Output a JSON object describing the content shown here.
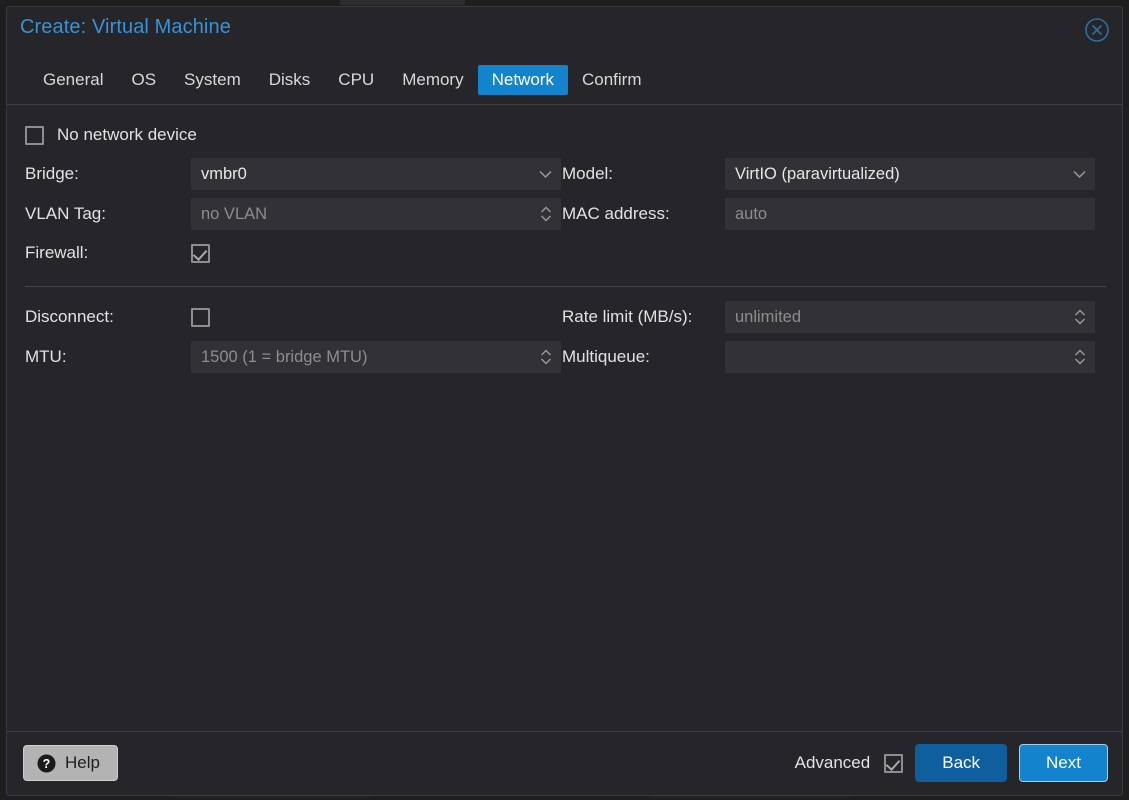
{
  "dialog": {
    "title": "Create: Virtual Machine",
    "close_icon": "close-circle-icon"
  },
  "tabs": [
    {
      "label": "General",
      "active": false
    },
    {
      "label": "OS",
      "active": false
    },
    {
      "label": "System",
      "active": false
    },
    {
      "label": "Disks",
      "active": false
    },
    {
      "label": "CPU",
      "active": false
    },
    {
      "label": "Memory",
      "active": false
    },
    {
      "label": "Network",
      "active": true
    },
    {
      "label": "Confirm",
      "active": false
    }
  ],
  "form": {
    "no_network_device": {
      "label": "No network device",
      "checked": false
    },
    "bridge": {
      "label": "Bridge:",
      "value": "vmbr0",
      "is_placeholder": false
    },
    "model": {
      "label": "Model:",
      "value": "VirtIO (paravirtualized)",
      "is_placeholder": false
    },
    "vlan_tag": {
      "label": "VLAN Tag:",
      "value": "no VLAN",
      "is_placeholder": true
    },
    "mac_address": {
      "label": "MAC address:",
      "value": "auto",
      "is_placeholder": true
    },
    "firewall": {
      "label": "Firewall:",
      "checked": true
    },
    "disconnect": {
      "label": "Disconnect:",
      "checked": false
    },
    "rate_limit": {
      "label": "Rate limit (MB/s):",
      "value": "unlimited",
      "is_placeholder": true
    },
    "mtu": {
      "label": "MTU:",
      "value": "1500 (1 = bridge MTU)",
      "is_placeholder": true
    },
    "multiqueue": {
      "label": "Multiqueue:",
      "value": "",
      "is_placeholder": true
    }
  },
  "footer": {
    "help_label": "Help",
    "help_icon": "question-circle-icon",
    "advanced_label": "Advanced",
    "advanced_checked": true,
    "back_label": "Back",
    "next_label": "Next"
  },
  "colors": {
    "accent": "#1383ce",
    "title": "#3892d4",
    "back_button": "#0f5e9e",
    "dialog_bg": "#26262a",
    "field_bg": "#323236",
    "help_bg": "#b3b3b3"
  }
}
